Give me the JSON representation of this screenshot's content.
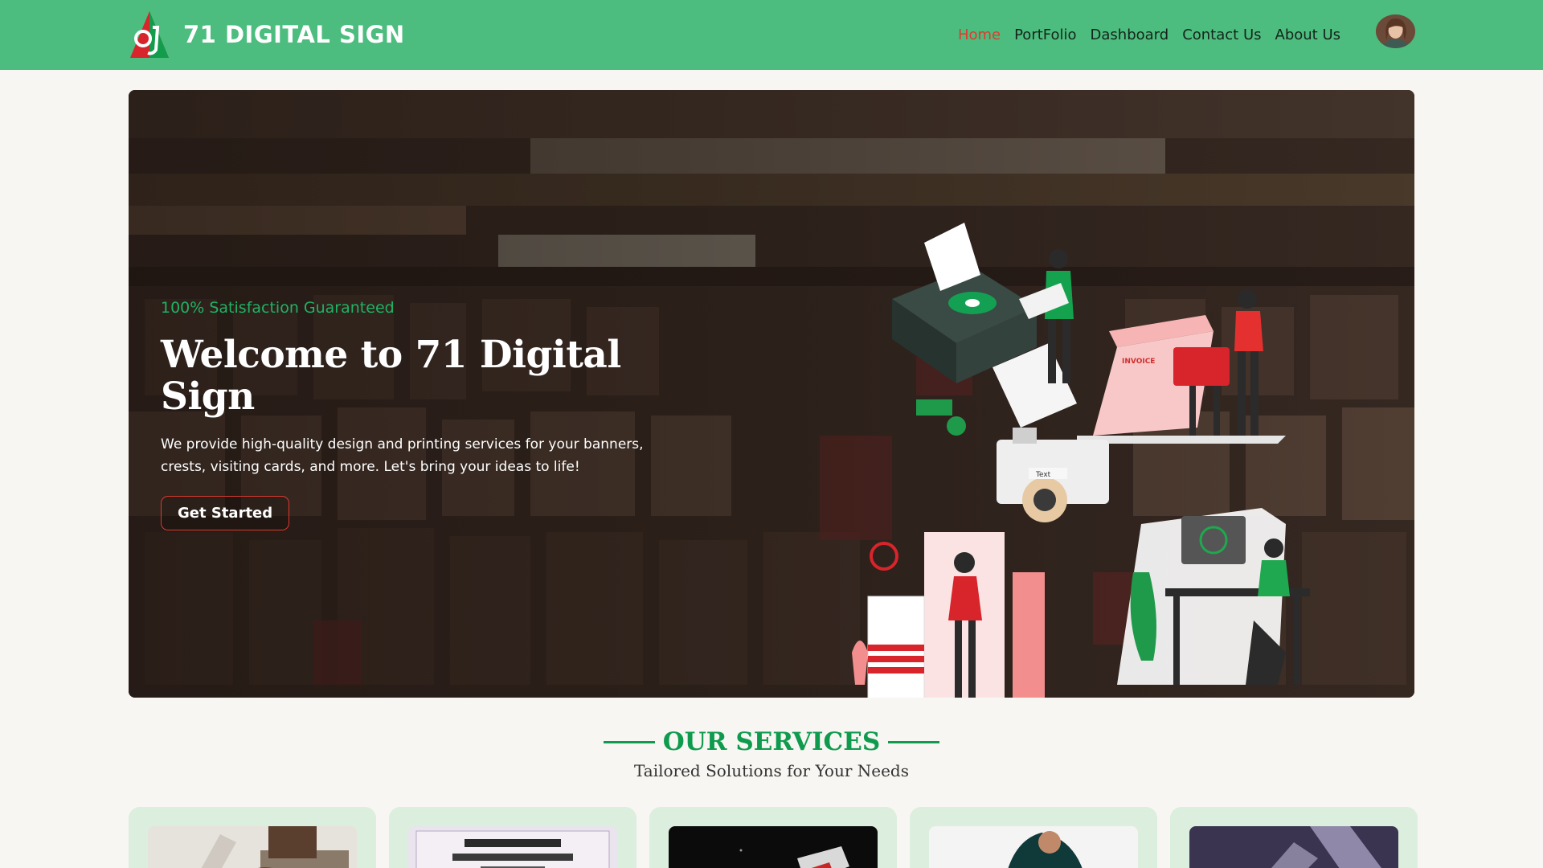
{
  "brand": {
    "name": "71 DIGITAL SIGN",
    "logo_icon": "71-logo-icon"
  },
  "nav": {
    "items": [
      {
        "label": "Home",
        "active": true
      },
      {
        "label": "PortFolio",
        "active": false
      },
      {
        "label": "Dashboard",
        "active": false
      },
      {
        "label": "Contact Us",
        "active": false
      },
      {
        "label": "About Us",
        "active": false
      }
    ],
    "avatar_icon": "user-avatar-icon"
  },
  "hero": {
    "tagline": "100% Satisfaction Guaranteed",
    "title": "Welcome to 71 Digital Sign",
    "description": "We provide high-quality design and printing services for your banners, crests, visiting cards, and more. Let's bring your ideas to life!",
    "cta_label": "Get Started",
    "invoice_label": "INVOICE",
    "text_label": "Text"
  },
  "services": {
    "title": "OUR SERVICES",
    "subtitle": "Tailored Solutions for Your Needs",
    "card_icons": [
      "banner-photo",
      "certificate-photo",
      "crest-photo",
      "mug-photo",
      "glass-photo"
    ]
  },
  "colors": {
    "nav_bg": "#4cbd7e",
    "accent_red": "#e03a2e",
    "accent_green": "#0f9b4e",
    "card_bg": "#dceedd"
  }
}
